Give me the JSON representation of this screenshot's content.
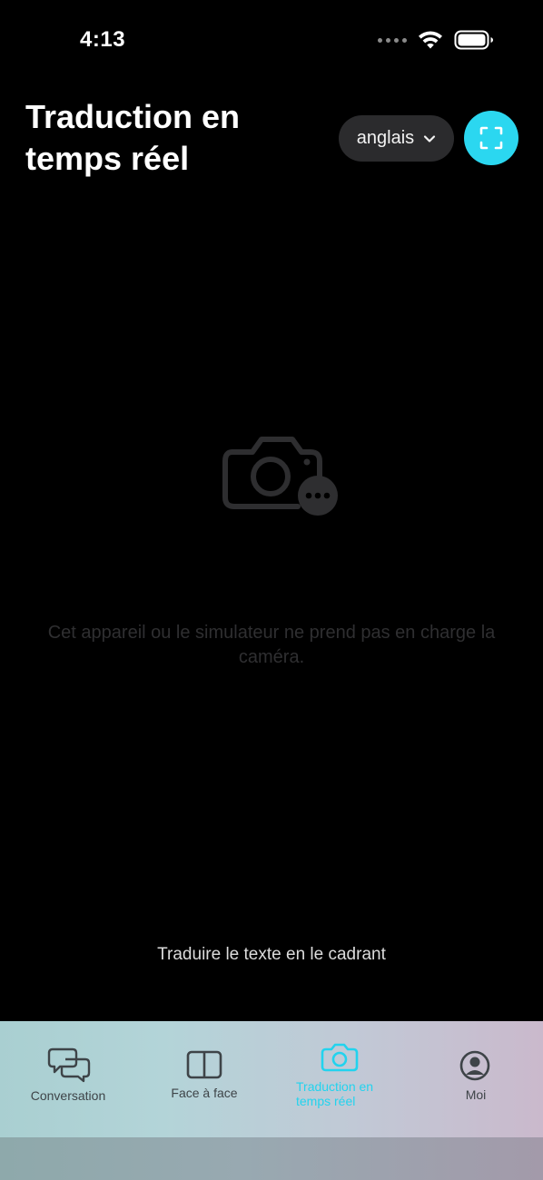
{
  "status_bar": {
    "time": "4:13"
  },
  "header": {
    "title": "Traduction en temps réel",
    "language_select": "anglais"
  },
  "camera": {
    "unsupported_message": "Cet appareil ou le simulateur ne prend pas en charge la caméra.",
    "hint": "Traduire le texte en le cadrant"
  },
  "tab_bar": {
    "tabs": [
      {
        "label": "Conversation",
        "icon": "chat-bubbles-icon",
        "active": false
      },
      {
        "label": "Face à face",
        "icon": "split-view-icon",
        "active": false
      },
      {
        "label": "Traduction en temps réel",
        "icon": "camera-icon",
        "active": true
      },
      {
        "label": "Moi",
        "icon": "profile-icon",
        "active": false
      }
    ]
  },
  "colors": {
    "accent": "#2bd7f0",
    "background": "#000000",
    "tab_bar_start": "#a9cfd1",
    "tab_bar_end": "#cab9cc"
  }
}
